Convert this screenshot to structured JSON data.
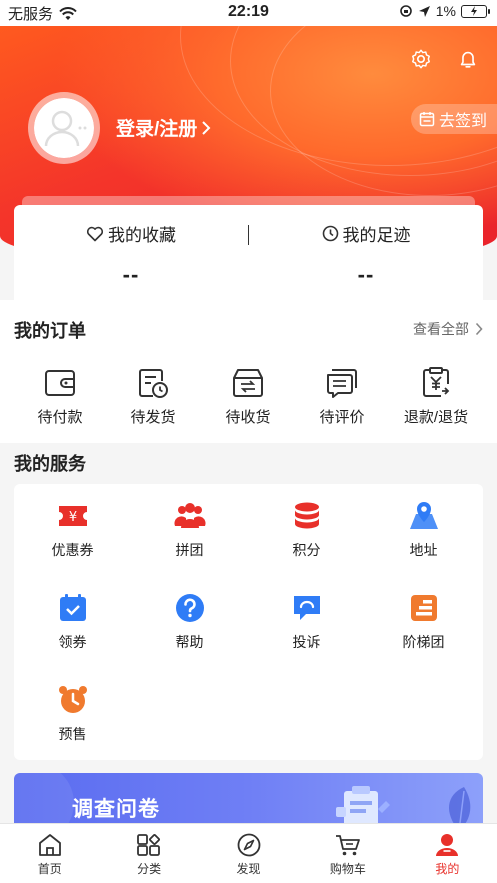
{
  "status_bar": {
    "carrier": "无服务",
    "time": "22:19",
    "battery": "1%"
  },
  "header": {
    "login_label": "登录/注册",
    "checkin_label": "去签到"
  },
  "stats": {
    "favorites": {
      "label": "我的收藏",
      "value": "--"
    },
    "footprints": {
      "label": "我的足迹",
      "value": "--"
    }
  },
  "orders": {
    "title": "我的订单",
    "see_all": "查看全部",
    "items": [
      {
        "label": "待付款",
        "icon": "wallet-icon"
      },
      {
        "label": "待发货",
        "icon": "clock-doc-icon"
      },
      {
        "label": "待收货",
        "icon": "box-icon"
      },
      {
        "label": "待评价",
        "icon": "comment-icon"
      },
      {
        "label": "退款/退货",
        "icon": "refund-icon"
      }
    ]
  },
  "services": {
    "title": "我的服务",
    "items": [
      {
        "label": "优惠券",
        "icon": "coupon-icon",
        "color": "#e8302a"
      },
      {
        "label": "拼团",
        "icon": "group-icon",
        "color": "#e8302a"
      },
      {
        "label": "积分",
        "icon": "coins-icon",
        "color": "#e8302a"
      },
      {
        "label": "地址",
        "icon": "location-icon",
        "color": "#2f7cf6"
      },
      {
        "label": "领券",
        "icon": "calendar-check-icon",
        "color": "#2f7cf6"
      },
      {
        "label": "帮助",
        "icon": "help-icon",
        "color": "#2f7cf6"
      },
      {
        "label": "投诉",
        "icon": "chat-icon",
        "color": "#2f7cf6"
      },
      {
        "label": "阶梯团",
        "icon": "ladder-icon",
        "color": "#f07a2e"
      },
      {
        "label": "预售",
        "icon": "alarm-icon",
        "color": "#f07a2e"
      }
    ]
  },
  "banner": {
    "title": "调查问卷"
  },
  "tabbar": {
    "items": [
      {
        "label": "首页",
        "icon": "home-icon",
        "active": false
      },
      {
        "label": "分类",
        "icon": "category-icon",
        "active": false
      },
      {
        "label": "发现",
        "icon": "compass-icon",
        "active": false
      },
      {
        "label": "购物车",
        "icon": "cart-icon",
        "active": false
      },
      {
        "label": "我的",
        "icon": "user-icon",
        "active": true
      }
    ]
  },
  "colors": {
    "accent": "#e8302a",
    "header_start": "#ff5a1f",
    "header_end": "#e8212b",
    "banner": "#6f7ff5"
  }
}
